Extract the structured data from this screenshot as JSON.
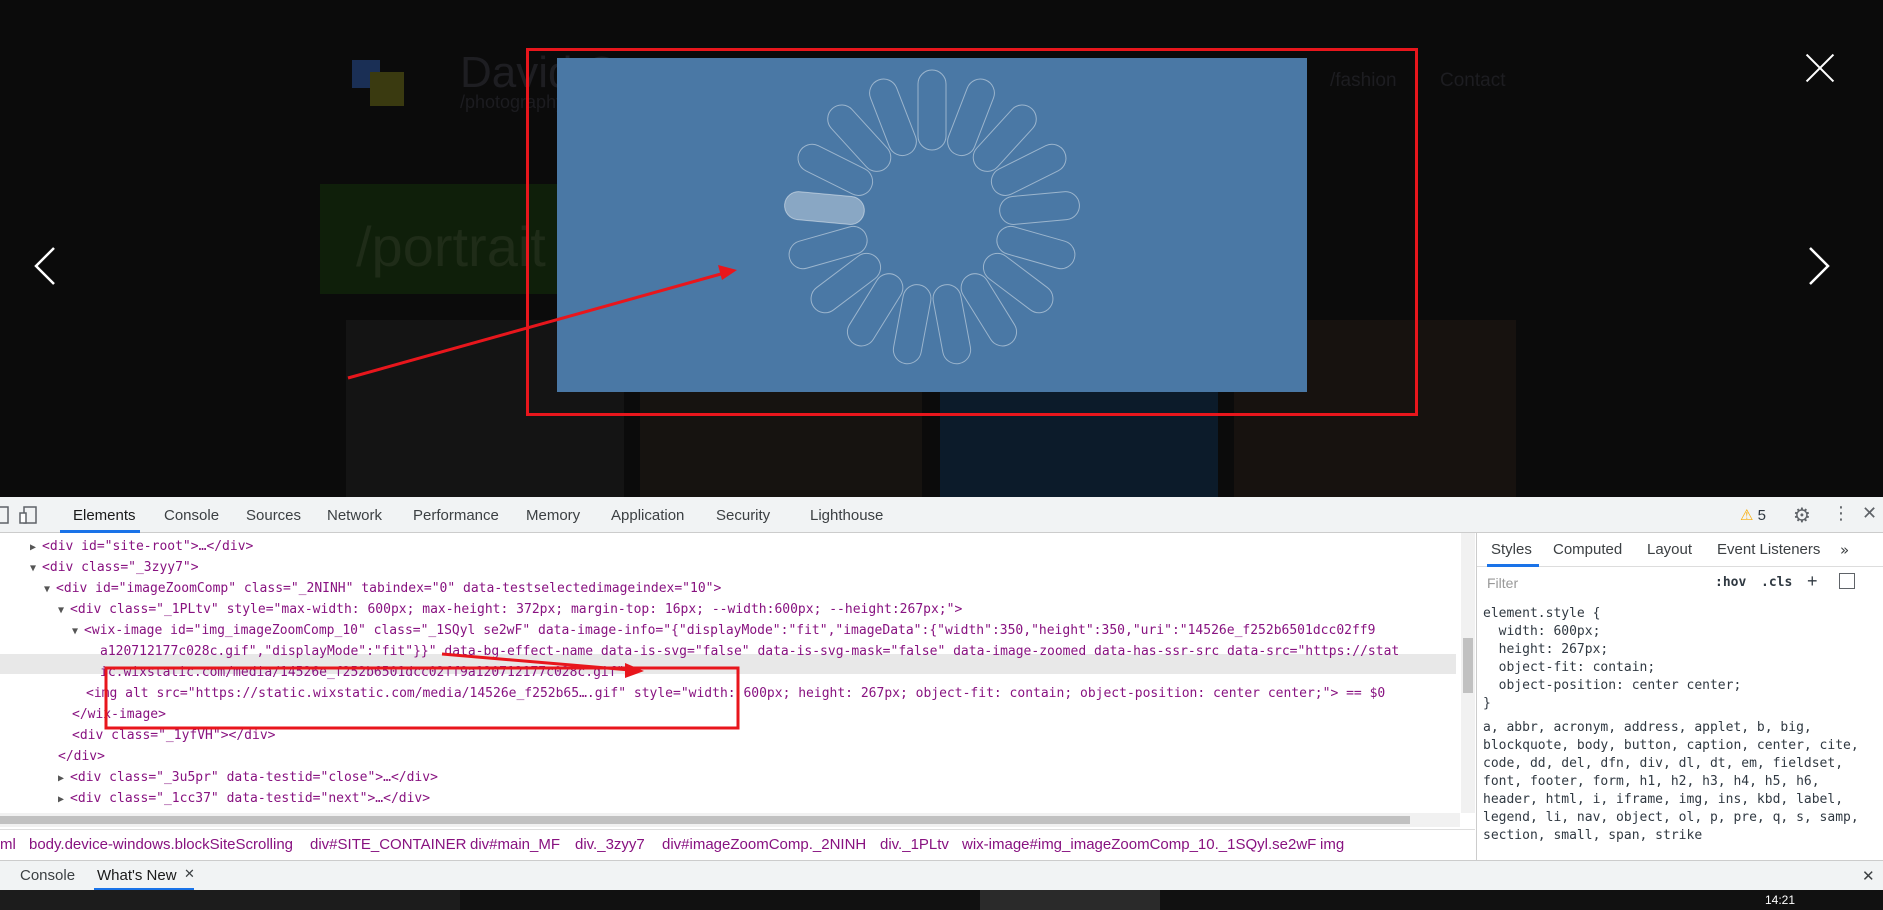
{
  "site": {
    "title": "David Cam",
    "subtitle": "/photography",
    "nav": [
      "/fashion",
      "Contact"
    ],
    "banner": "/portrait"
  },
  "lightbox": {
    "prev_icon": "chevron-left-icon",
    "next_icon": "chevron-right-icon",
    "close_icon": "close-icon",
    "image_color": "#4a78a5",
    "spinner_icon": "spinner-icon"
  },
  "devtools": {
    "tabs": [
      "Elements",
      "Console",
      "Sources",
      "Network",
      "Performance",
      "Memory",
      "Application",
      "Security",
      "Lighthouse"
    ],
    "warning_count": "5",
    "dom_lines": [
      {
        "indent": 0,
        "tri": "▶",
        "text": "<div id=\"site-root\">…</div>"
      },
      {
        "indent": 0,
        "tri": "▼",
        "text": "<div class=\"_3zyy7\">"
      },
      {
        "indent": 1,
        "tri": "▼",
        "text": "<div id=\"imageZoomComp\" class=\"_2NINH\" tabindex=\"0\" data-testselectedimageindex=\"10\">"
      },
      {
        "indent": 2,
        "tri": "▼",
        "text": "<div class=\"_1PLtv\" style=\"max-width: 600px; max-height: 372px; margin-top: 16px; --width:600px; --height:267px;\">"
      },
      {
        "indent": 3,
        "tri": "▼",
        "text": "<wix-image id=\"img_imageZoomComp_10\" class=\"_1SQyl se2wF\" data-image-info=\"{\"displayMode\":\"fit\",\"imageData\":{\"width\":350,\"height\":350,\"uri\":\"14526e_f252b6501dcc02ff9"
      },
      {
        "indent": 5,
        "tri": "",
        "text": "a120712177c028c.gif\",\"displayMode\":\"fit\"}}\" data-bg-effect-name data-is-svg=\"false\" data-is-svg-mask=\"false\" data-image-zoomed data-has-ssr-src data-src=\"https://stat"
      },
      {
        "indent": 5,
        "tri": "",
        "text": "ic.wixstatic.com/media/14526e_f252b6501dcc02ff9a120712177c028c.gif\">"
      },
      {
        "indent": 4,
        "tri": "",
        "text": "<img alt src=\"https://static.wixstatic.com/media/14526e_f252b65….gif\" style=\"width: 600px; height: 267px; object-fit: contain; object-position: center center;\"> == $0"
      },
      {
        "indent": 3,
        "tri": "",
        "text": "</wix-image>"
      },
      {
        "indent": 3,
        "tri": "",
        "text": "<div class=\"_1yfVH\"></div>"
      },
      {
        "indent": 2,
        "tri": "",
        "text": "</div>"
      },
      {
        "indent": 2,
        "tri": "▶",
        "text": "<div class=\"_3u5pr\" data-testid=\"close\">…</div>"
      },
      {
        "indent": 2,
        "tri": "▶",
        "text": "<div class=\"_1cc37\" data-testid=\"next\">…</div>"
      }
    ],
    "breadcrumbs": [
      "ml",
      "body.device-windows.blockSiteScrolling",
      "div#SITE_CONTAINER",
      "div#main_MF",
      "div._3zyy7",
      "div#imageZoomComp._2NINH",
      "div._1PLtv",
      "wix-image#img_imageZoomComp_10._1SQyl.se2wF",
      "img"
    ],
    "styles_tabs": [
      "Styles",
      "Computed",
      "Layout",
      "Event Listeners"
    ],
    "filter_placeholder": "Filter",
    "filter_hov": ":hov",
    "filter_cls": ".cls",
    "element_style": "element.style {\n  width: 600px;\n  height: 267px;\n  object-fit: contain;\n  object-position: center center;\n}",
    "inherited_selectors": "a, abbr, acronym, address, applet, b, big, blockquote, body, button, caption, center, cite, code, dd, del, dfn, div, dl, dt, em, fieldset, font, footer, form, h1, h2, h3, h4, h5, h6, header, html, i, iframe, img, ins, kbd, label, legend, li, nav, object, ol, p, pre, q, s, samp, section, small, span, strike",
    "drawer_tabs": [
      "Console",
      "What's New"
    ]
  },
  "taskbar": {
    "time": "14:21"
  }
}
